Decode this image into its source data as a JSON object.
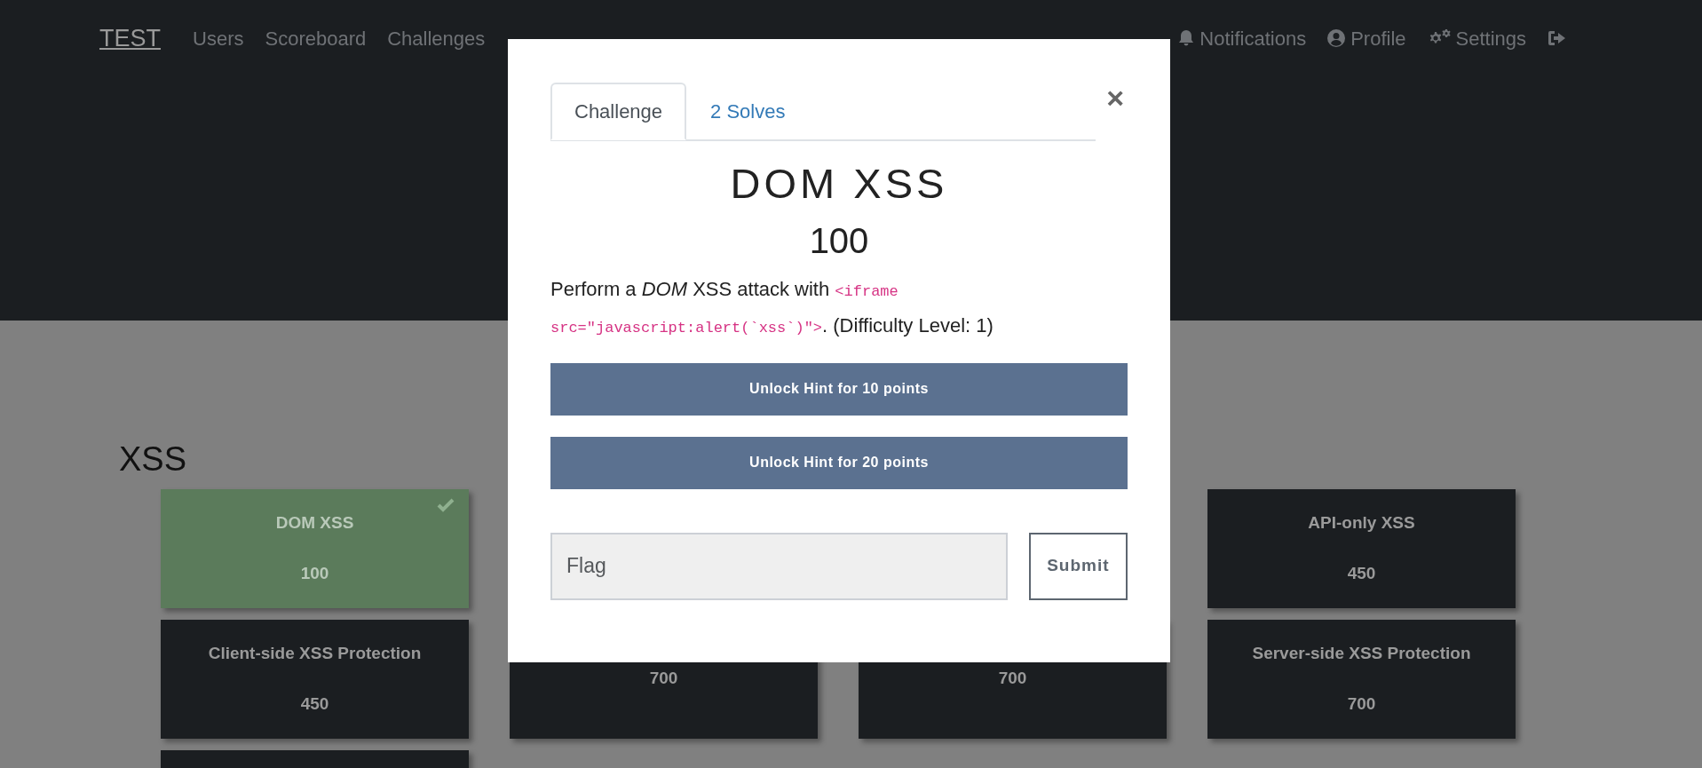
{
  "navbar": {
    "brand": "TEST",
    "links": [
      {
        "label": "Users"
      },
      {
        "label": "Scoreboard"
      },
      {
        "label": "Challenges"
      }
    ],
    "right_links": [
      {
        "kind": "notifications",
        "label": "Notifications"
      },
      {
        "kind": "profile",
        "label": "Profile"
      },
      {
        "kind": "settings",
        "label": "Settings"
      },
      {
        "kind": "logout"
      }
    ]
  },
  "category": "XSS",
  "challenge_rows": [
    [
      {
        "name": "DOM XSS",
        "points": "100",
        "solved": true
      },
      {
        "name": "API-only XSS",
        "points": "450",
        "solved": false
      }
    ],
    [
      {
        "name": "Client-side XSS Protection",
        "points": "450",
        "solved": false
      },
      {
        "points": "700",
        "solved": false
      },
      {
        "points": "700",
        "solved": false
      },
      {
        "name": "Server-side XSS Protection",
        "points": "700",
        "solved": false
      }
    ],
    [
      {
        "solved": false
      }
    ]
  ],
  "modal": {
    "tabs": [
      {
        "label": "Challenge",
        "selected": true
      },
      {
        "label": "2 Solves",
        "selected": false
      }
    ],
    "close": "×",
    "title": "DOM XSS",
    "points": "100",
    "description": [
      {
        "kind": "text",
        "text": "Perform a *DOM* XSS attack with "
      },
      {
        "kind": "code",
        "text": "<iframe src=\"javascript:alert(`xss`)\">"
      },
      {
        "kind": "text",
        "text": ". (Difficulty Level: 1)"
      }
    ],
    "hints": [
      {
        "label": "Unlock Hint for 10 points"
      },
      {
        "label": "Unlock Hint for 20 points"
      }
    ],
    "flag": {
      "placeholder": "Flag"
    },
    "submit": "Submit"
  }
}
